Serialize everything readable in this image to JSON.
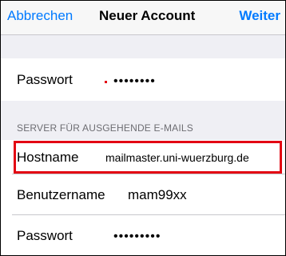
{
  "navbar": {
    "cancel_label": "Abbrechen",
    "title": "Neuer Account",
    "next_label": "Weiter"
  },
  "incoming": {
    "password_label": "Passwort",
    "password_value": "••••••••"
  },
  "outgoing": {
    "section_title": "SERVER FÜR AUSGEHENDE E-MAILS",
    "hostname_label": "Hostname",
    "hostname_value": "mailmaster.uni-wuerzburg.de",
    "username_label": "Benutzername",
    "username_value": "mam99xx",
    "password_label": "Passwort",
    "password_value": "•••••••••"
  },
  "colors": {
    "accent": "#007aff",
    "highlight": "#e30613"
  }
}
